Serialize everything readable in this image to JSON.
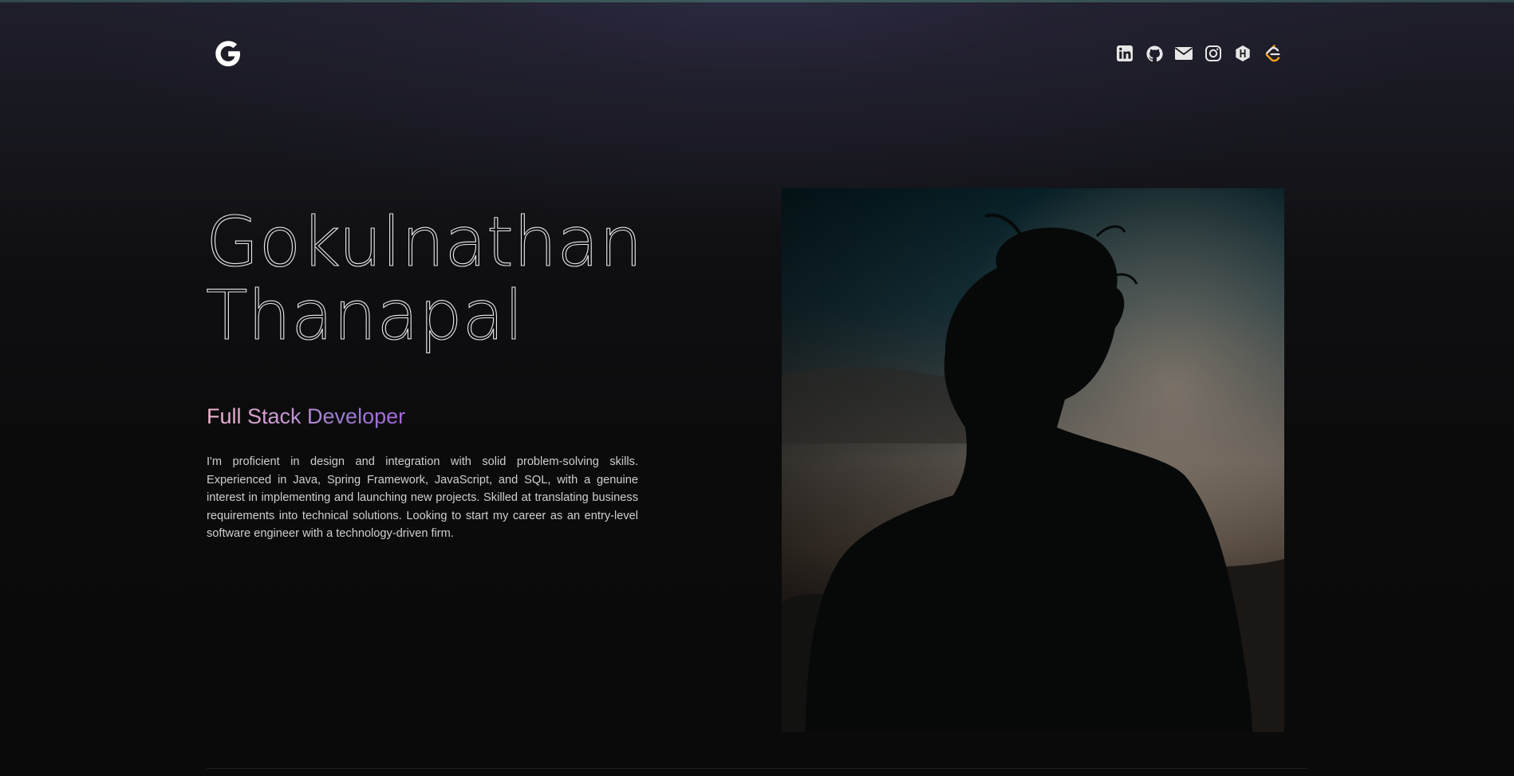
{
  "header": {
    "logo_letter": "G",
    "social_links": [
      {
        "name": "linkedin-icon",
        "label": "LinkedIn"
      },
      {
        "name": "github-icon",
        "label": "GitHub"
      },
      {
        "name": "mail-icon",
        "label": "Email"
      },
      {
        "name": "instagram-icon",
        "label": "Instagram"
      },
      {
        "name": "hashnode-icon",
        "label": "Hashnode"
      },
      {
        "name": "leetcode-icon",
        "label": "LeetCode"
      }
    ]
  },
  "hero": {
    "first_name": "Gokulnathan",
    "last_name": "Thanapal",
    "role": "Full Stack Developer",
    "bio": "I'm proficient in design and integration with solid problem-solving skills. Experienced in Java, Spring Framework, JavaScript, and SQL, with a genuine interest in implementing and launching new projects. Skilled at translating business requirements into technical solutions. Looking to start my career as an entry-level software engineer with a technology-driven firm."
  },
  "colors": {
    "accent_pink": "#f0b6cf",
    "accent_purple": "#a766dc",
    "leetcode_orange": "#f6a11a"
  }
}
